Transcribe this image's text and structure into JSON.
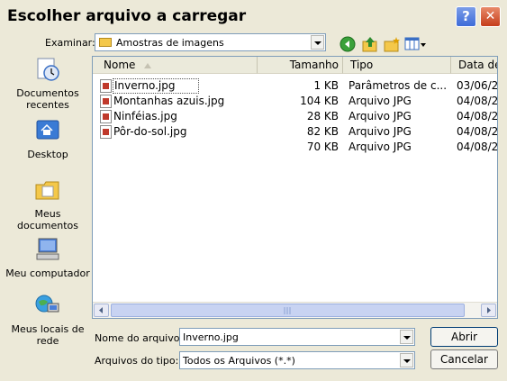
{
  "window": {
    "title": "Escolher arquivo a carregar",
    "help_glyph": "?",
    "close_glyph": "✕"
  },
  "toolbar": {
    "look_in_label": "Examinar:",
    "look_in_value": "Amostras de imagens",
    "icons": [
      "back-icon",
      "up-folder-icon",
      "new-folder-icon",
      "view-menu-icon"
    ]
  },
  "places": [
    {
      "label": "Documentos recentes",
      "icon": "recent-documents-icon"
    },
    {
      "label": "Desktop",
      "icon": "desktop-icon"
    },
    {
      "label": "Meus documentos",
      "icon": "my-documents-icon"
    },
    {
      "label": "Meu computador",
      "icon": "my-computer-icon"
    },
    {
      "label": "Meus locais de rede",
      "icon": "network-places-icon"
    }
  ],
  "list": {
    "columns": [
      "Nome",
      "Tamanho",
      "Tipo",
      "Data de"
    ],
    "rows": [
      {
        "name": "Inverno.jpg",
        "size": "1 KB",
        "type": "Parâmetros de c...",
        "date": "03/06/2"
      },
      {
        "name": "Montanhas azuis.jpg",
        "size": "104 KB",
        "type": "Arquivo JPG",
        "date": "04/08/2"
      },
      {
        "name": "Ninféias.jpg",
        "size": "28 KB",
        "type": "Arquivo JPG",
        "date": "04/08/2"
      },
      {
        "name": "Pôr-do-sol.jpg",
        "size": "82 KB",
        "type": "Arquivo JPG",
        "date": "04/08/2"
      },
      {
        "name": "",
        "size": "70 KB",
        "type": "Arquivo JPG",
        "date": "04/08/2"
      }
    ]
  },
  "filename": {
    "label": "Nome do arquivo:",
    "value": "Inverno.jpg"
  },
  "filetype": {
    "label": "Arquivos do tipo:",
    "value": "Todos os Arquivos (*.*)"
  },
  "buttons": {
    "open": "Abrir",
    "cancel": "Cancelar"
  },
  "colors": {
    "title_close": "#c53d1a",
    "title_help": "#3d6bd8",
    "folder": "#f4c84a"
  }
}
